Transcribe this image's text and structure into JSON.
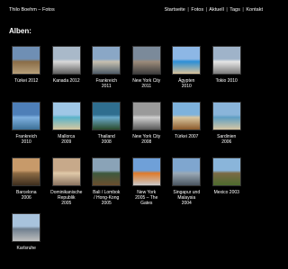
{
  "header": {
    "site_title": "Thilo Boehm – Fotos",
    "nav": [
      {
        "label": "Startseite"
      },
      {
        "label": "Fotos"
      },
      {
        "label": "Aktuell"
      },
      {
        "label": "Tags"
      },
      {
        "label": "Kontakt"
      }
    ],
    "separator": "|"
  },
  "main": {
    "section_title": "Alben:",
    "albums": [
      {
        "name": "Türkei 2012",
        "colors": [
          "#6f8fb4",
          "#8a6c47",
          "#b7a07a"
        ]
      },
      {
        "name": "Kanada 2012",
        "colors": [
          "#a9b9c9",
          "#d9d9d9",
          "#5f5f5f"
        ]
      },
      {
        "name": "Frankreich\n2011",
        "colors": [
          "#8aa7c6",
          "#c7c0b0",
          "#4e5b67"
        ]
      },
      {
        "name": "New York City\n2011",
        "colors": [
          "#7b8a9a",
          "#9c8b7a",
          "#3e3e3e"
        ]
      },
      {
        "name": "Ägypten\n2010",
        "colors": [
          "#8db7e5",
          "#2c8fd6",
          "#d9c29a"
        ]
      },
      {
        "name": "Tokio 2010",
        "colors": [
          "#9fb3c9",
          "#e6e6e6",
          "#7a7a7a"
        ]
      },
      {
        "name": "Frankreich\n2010",
        "colors": [
          "#4e7fb8",
          "#7fb1e0",
          "#3c6f96"
        ]
      },
      {
        "name": "Mallorca\n2009",
        "colors": [
          "#9fc7e6",
          "#5ab3c9",
          "#d8c89f"
        ]
      },
      {
        "name": "Thailand\n2008",
        "colors": [
          "#2f6e8f",
          "#6aa9c9",
          "#2a4a2a"
        ]
      },
      {
        "name": "New York City\n2008",
        "colors": [
          "#9a9a9a",
          "#cfcfcf",
          "#585858"
        ]
      },
      {
        "name": "Türkei 2007",
        "colors": [
          "#7eb2dc",
          "#d9c6a0",
          "#8b5a2b"
        ]
      },
      {
        "name": "Sardinien\n2006",
        "colors": [
          "#8ab5da",
          "#5f9fc3",
          "#d7c7a3"
        ]
      },
      {
        "name": "Barcelona\n2006",
        "colors": [
          "#c79a6a",
          "#8c6b44",
          "#3d2e1e"
        ]
      },
      {
        "name": "Dominikanische\nRepublik\n2005",
        "colors": [
          "#c7a98a",
          "#e0c9a9",
          "#8a7360"
        ]
      },
      {
        "name": "Bali / Lombok\n/ Hong-Kong\n2005",
        "colors": [
          "#8aa3b7",
          "#3e5a3e",
          "#6b4e2e"
        ]
      },
      {
        "name": "New York\n2005 – The\nGates",
        "colors": [
          "#6fa0d8",
          "#e07a2a",
          "#c9c9c9"
        ]
      },
      {
        "name": "Singapur und\nMalaysia\n2004",
        "colors": [
          "#7fa6cf",
          "#9aa9b6",
          "#4a5560"
        ]
      },
      {
        "name": "Mexico 2003",
        "colors": [
          "#8ab5da",
          "#7b6a45",
          "#4d6b2e"
        ]
      },
      {
        "name": "Karlsruhe",
        "colors": [
          "#a8c3dc",
          "#6f7f8f",
          "#bfbfbf"
        ]
      }
    ]
  }
}
